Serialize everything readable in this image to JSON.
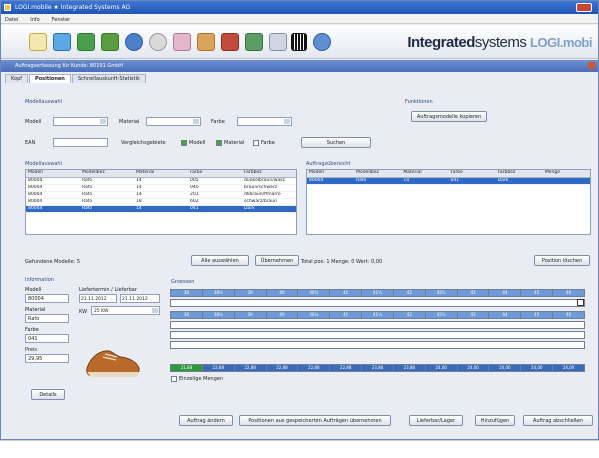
{
  "window": {
    "title": "LOGI.mobile ★ Integrated Systems AG"
  },
  "menubar": [
    "Datei",
    "Info",
    "Fenster"
  ],
  "brand": {
    "strong": "Integrated",
    "thin": "systems",
    "product": "LOGI.mobi"
  },
  "document": {
    "title": "Auftragserfassung für Kunde: 80191 GmbH"
  },
  "tabs": [
    "Kopf",
    "Positionen",
    "Schnellauskunft-Statistik"
  ],
  "filters": {
    "section_label": "Modellauswahl",
    "modell_label": "Modell",
    "material_label": "Material",
    "farbe_label": "Farbe",
    "ean_label": "EAN",
    "vergleich_label": "Vergleichsgebiete",
    "check_modell": "Modell",
    "check_material": "Material",
    "check_farbe": "Farbe",
    "search_button": "Suchen"
  },
  "actions": {
    "section_label": "Funktionen",
    "auftragsmodelle_button": "Auftragsmodelle kopieren"
  },
  "model_list": {
    "section_label": "Modellauswahl",
    "columns": [
      "Modell",
      "Modellbez",
      "Material",
      "Farbe",
      "Farbbez"
    ],
    "rows": [
      [
        "80004",
        "Rafo",
        "14",
        "005",
        "dunkelbraun/wasz"
      ],
      [
        "80004",
        "Rafo",
        "14",
        "040",
        "braun/schwarz"
      ],
      [
        "80004",
        "Rafo",
        "14",
        "201",
        "dkbraun/ffmarro"
      ],
      [
        "80004",
        "Rafo",
        "18",
        "602",
        "schwarz/braun"
      ],
      [
        "80004",
        "Rafo",
        "14",
        "041",
        "Dark"
      ]
    ],
    "selected_index": 4,
    "count_text": "Gefundene Modelle: 5"
  },
  "order_list": {
    "section_label": "Auftragsübersicht",
    "columns": [
      "Modell",
      "Modellbez",
      "Material",
      "Farbe",
      "Farbbez",
      "Menge"
    ],
    "rows": [
      [
        "80004",
        "Rafo",
        "14",
        "041",
        "Dark",
        ""
      ]
    ]
  },
  "mid_buttons": {
    "alle_auswaehlen": "Alle auswählen",
    "uebernehmen": "Übernehmen",
    "totals": "Total pos: 1    Menge: 0    Wert: 0,00",
    "pos_loeschen": "Position löschen"
  },
  "info": {
    "section_label": "Information",
    "modell_label": "Modell",
    "modell_value": "80004",
    "material_label": "Material",
    "material_value": "Rafo",
    "farbe_label": "Farbe",
    "farbe_value": "041",
    "preis_label": "Preis",
    "preis_value": "29,95",
    "liefertermin_label": "Liefertermin / Lieferbar",
    "liefertermin_value": "21.11.2012",
    "lieferbar_value": "21.11.2012",
    "kw_label": "KW",
    "kw_value": "25 KW",
    "details_button": "Details"
  },
  "sizes": {
    "section_label": "Groessen",
    "header_sizes": [
      "38",
      "38½",
      "39",
      "40",
      "40½",
      "41",
      "41½",
      "42",
      "42½",
      "43",
      "44",
      "45",
      "46"
    ],
    "prices": [
      "21,88",
      "22,88",
      "22,88",
      "22,88",
      "22,88",
      "22,88",
      "23,88",
      "23,88",
      "24,00",
      "24,00",
      "24,00",
      "24,00",
      "24,00"
    ],
    "check_label": "Einzelige Mengen"
  },
  "bottom_buttons": [
    "Auftrag ändern",
    "Positionen aus gespeicherten Aufträgen übernehmen",
    "Lieferbar/Lager",
    "Hinzufügen",
    "Auftrag abschließen"
  ],
  "colors": {
    "accent": "#316ac5",
    "title_blue": "#1f55b4",
    "brand_dark": "#1e2b46",
    "brand_light": "#7f9ed0",
    "shoe": "#b96a2a",
    "size_cell_blue": "#6d9bd6",
    "price_green": "#2f9b37"
  }
}
